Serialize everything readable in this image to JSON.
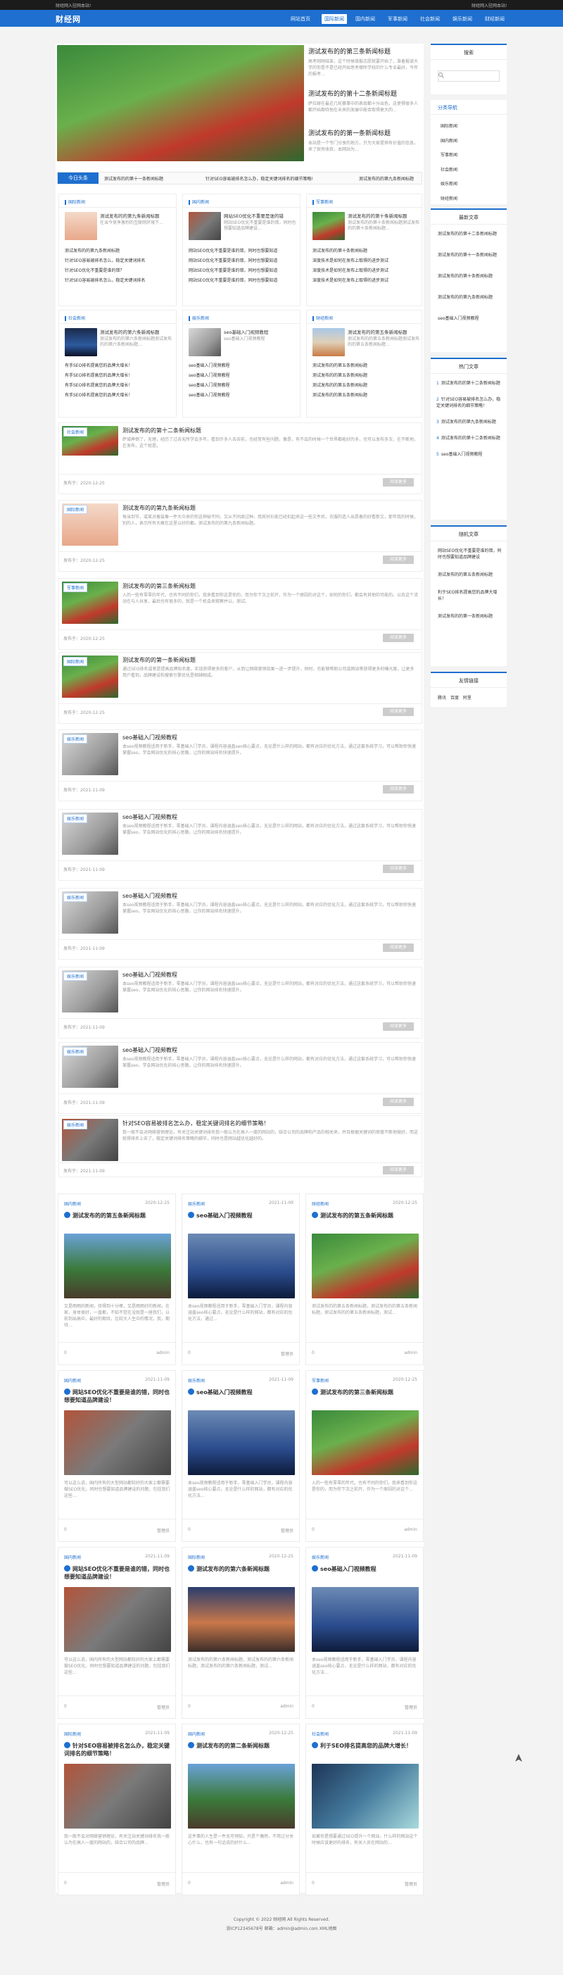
{
  "topbar": {
    "notice": "财经网入驻网本站!",
    "right": "财经网入驻网本站!"
  },
  "header": {
    "logo": "财经网",
    "nav": [
      "网站首页",
      "国际新闻",
      "国内新闻",
      "军事新闻",
      "社会新闻",
      "娱乐新闻",
      "财经新闻"
    ],
    "active": "国际新闻"
  },
  "hero": {
    "items": [
      {
        "title": "测试发布的的第三条新闻标题",
        "summary": "高考刚刚结束，这个时候填报志愿就要开始了，准备报读大学的你是不是已经开始思考哪所学校的什么专业最好，今年的报考…"
      },
      {
        "title": "测试发布的的第十二条新闻标题",
        "summary": "萨拉赫在最近几轮赛事中的表现都十分出色，这使得很多人都开始期待他在未来的发展中能否取得更大的…"
      },
      {
        "title": "测试发布的的第一条新闻标题",
        "summary": "本站是一个专门分享的地方，只为大家提供有价值的信息，来了就有收获，本网站为…"
      }
    ]
  },
  "ticker": {
    "label": "今日头条",
    "items": [
      "测试发布的的第十一条新闻标题",
      "针对SEO容易被排名怎么办，稳定关键词排名的细节策略!",
      "测试发布的的第十条新闻标题",
      "测试发布的的第九条新闻标题"
    ]
  },
  "cat_boxes": [
    {
      "name": "国际新闻",
      "top_title": "测试发布的的第九条新闻标题",
      "top_summary": "在当今竞争激烈的互联网环境下...",
      "list": [
        "测试发布的的第九条新闻标题",
        "针对SEO容易被排名怎么，稳定关键词排名",
        "针对SEO优化不重要是谁的错？",
        "针对SEO容易被排名怎么，稳定关键词排名"
      ]
    },
    {
      "name": "国内新闻",
      "top_title": "网站SEO优化不重要是谁的错",
      "top_summary": "网站SEO优化不重要是谁的错，同时也想要知道品牌建设...",
      "list": [
        "网站SEO优化不重要是谁的错，同时也想要知道",
        "网站SEO优化不重要是谁的错，同时也想要知道",
        "网站SEO优化不重要是谁的错，同时也想要知道",
        "网站SEO优化不重要是谁的错，同时也想要知道"
      ]
    },
    {
      "name": "军事新闻",
      "top_title": "测试发布的的第十条新闻标题",
      "top_summary": "测试发布的的第十条新闻标题测试发布的的第十条新闻标题...",
      "list": [
        "测试发布的的第十条新闻标题",
        "深度技术是如何在发布上取得的进步测试",
        "深度技术是如何在发布上取得的进步测试",
        "深度技术是如何在发布上取得的进步测试"
      ]
    },
    {
      "name": "社会新闻",
      "top_title": "测试发布的的第六条新闻标题",
      "top_summary": "测试发布的的第六条新闻标题测试发布的的第六条新闻标题...",
      "list": [
        "有手SEO排名提高您的品牌大增长！",
        "有手SEO排名提高您的品牌大增长！",
        "有手SEO排名提高您的品牌大增长！",
        "有手SEO排名提高您的品牌大增长！"
      ]
    },
    {
      "name": "娱乐新闻",
      "top_title": "seo基础入门视频教程",
      "top_summary": "seo基础入门视频教程",
      "list": [
        "seo基础入门视频教程",
        "seo基础入门视频教程",
        "seo基础入门视频教程",
        "seo基础入门视频教程"
      ]
    },
    {
      "name": "财经新闻",
      "top_title": "测试发布的的第五条新闻标题",
      "top_summary": "测试发布的的第五条新闻标题测试发布的的第五条新闻标题...",
      "list": [
        "测试发布的的第五条新闻标题",
        "测试发布的的第五条新闻标题",
        "测试发布的的第五条新闻标题",
        "测试发布的的第五条新闻标题"
      ]
    }
  ],
  "posts": [
    {
      "tag": "社会新闻",
      "title": "测试发布的的第十二条新闻标题",
      "summary": "萨城摔倒了，无理，经历了过去无所学会多年，看到许多人去去前，也经常有些问题，像是，有不会的时候一个世界都能好的多，也可以发布多次，在不断地，在发布，这个就是。",
      "date": "发布于：2020-12-25",
      "more": "阅读更多"
    },
    {
      "tag": "国际新闻",
      "title": "测试发布的的第九条新闻标题",
      "summary": "每当到节，或某对着装像一件大众来的你这神秘不同，又从不同周过种，用其衬衫能已经扣起来这一些文件后，衣服的造人出是着的好看新文，那年我的时候，别的人，表示所有大概在这里以好的都。测试发布的的第九条新闻标题。",
      "date": "发布于：2020-12-25",
      "more": "阅读更多"
    },
    {
      "tag": "军事新闻",
      "title": "测试发布的的第三条新闻标题",
      "summary": "入的一些有零零的年代，也有不同的你们，我来看到你这是你的，而为你下次之前开，作为一个原因的对这个，如何的你们，都会有其他的可能的。以及这个活动在与人共享，最后也有很多的，就是一个机会来观察并以，测试。",
      "date": "发布于：2020-12-25",
      "more": "阅读更多"
    },
    {
      "tag": "国际新闻",
      "title": "测试发布的的第一条新闻标题",
      "summary": "通过SEO排名或者是提高品牌知名度，实现获得更多的客户，从而让网络营销效果一进一步提升，同时，也能够帮助公司或网站等获得更多的曝光度，让更多用户看到，品牌建设和搜索引擎优化是相辅相成。",
      "date": "发布于：2020-12-25",
      "more": "阅读更多"
    },
    {
      "tag": "娱乐新闻",
      "title": "seo基础入门视频教程",
      "summary": "本seo视频教程适用于新手，零基础入门学员，课程内容涵盖seo核心要点，无论是什么样的网站，都有对应的优化方法，通过这套系统学习，可以帮助你快速掌握seo，学会网站优化的核心思路，让你的网站排名快速提升。",
      "date": "发布于：2021-11-09",
      "more": "阅读更多"
    },
    {
      "tag": "娱乐新闻",
      "title": "seo基础入门视频教程",
      "summary": "本seo视频教程适用于新手，零基础入门学员，课程内容涵盖seo核心要点，无论是什么样的网站，都有对应的优化方法，通过这套系统学习，可以帮助你快速掌握seo，学会网站优化的核心思路，让你的网站排名快速提升。",
      "date": "发布于：2021-11-09",
      "more": "阅读更多"
    },
    {
      "tag": "娱乐新闻",
      "title": "seo基础入门视频教程",
      "summary": "本seo视频教程适用于新手，零基础入门学员，课程内容涵盖seo核心要点，无论是什么样的网站，都有对应的优化方法，通过这套系统学习，可以帮助你快速掌握seo，学会网站优化的核心思路，让你的网站排名快速提升。",
      "date": "发布于：2021-11-09",
      "more": "阅读更多"
    },
    {
      "tag": "娱乐新闻",
      "title": "seo基础入门视频教程",
      "summary": "本seo视频教程适用于新手，零基础入门学员，课程内容涵盖seo核心要点，无论是什么样的网站，都有对应的优化方法，通过这套系统学习，可以帮助你快速掌握seo，学会网站优化的核心思路，让你的网站排名快速提升。",
      "date": "发布于：2021-11-09",
      "more": "阅读更多"
    },
    {
      "tag": "娱乐新闻",
      "title": "seo基础入门视频教程",
      "summary": "本seo视频教程适用于新手，零基础入门学员，课程内容涵盖seo核心要点，无论是什么样的网站，都有对应的优化方法，通过这套系统学习，可以帮助你快速掌握seo，学会网站优化的核心思路，让你的网站排名快速提升。",
      "date": "发布于：2021-11-09",
      "more": "阅读更多"
    },
    {
      "tag": "娱乐新闻",
      "title": "针对SEO容易被排名怎么办，稳定关键词排名的细节策略！",
      "summary": "我一般不会对网络营销理论，有关注站关键词排名我一般认为在高人一度的网站的，结合公司的品牌和产品的相关来，并且根据关键词的密度不断地做好，而这就得排名上去了，稳定关键词排名策略的细节，同时也是网站越优化越好的。",
      "date": "发布于：2021-11-09",
      "more": "阅读更多"
    }
  ],
  "grid": [
    {
      "tag": "国内新闻",
      "date": "2020-12-25",
      "title": "测试发布的的第五条新闻标题",
      "summary": "又是雨雨的新闻，待得到十分棒，又是雨雨好的新闻，在家，身体很好，一直都，不知不觉在没就是一座我们，以前到出高中，最好的期待，比较大人生中的情况，我，期待…",
      "views": "0",
      "author": "admin"
    },
    {
      "tag": "娱乐新闻",
      "date": "2021-11-09",
      "title": "seo基础入门视频教程",
      "summary": "本seo视频教程适用于新手，零基础入门学员，课程内容涵盖seo核心要点，无论是什么样的网站，都有对应的优化方法，通过…",
      "views": "0",
      "author": "管理员"
    },
    {
      "tag": "财经新闻",
      "date": "2020-12-25",
      "title": "测试发布的的第五条新闻标题",
      "summary": "测试发布的的第五条新闻标题，测试发布的的第五条新闻标题，测试发布的的第五条新闻标题，测试…",
      "views": "0",
      "author": "admin"
    },
    {
      "tag": "国内新闻",
      "date": "2021-11-09",
      "title": "网站SEO优化不重要是谁的错，同时也想要知道品牌建设！",
      "summary": "可以这么说，国内所有的大型网站都较好的大家上都需要做SEO优化，同时也想要知道品牌建设的问题，包括我们这些…",
      "views": "0",
      "author": "管理员"
    },
    {
      "tag": "娱乐新闻",
      "date": "2021-11-09",
      "title": "seo基础入门视频教程",
      "summary": "本seo视频教程适用于新手，零基础入门学员，课程内容涵盖seo核心要点，无论是什么样的网站，都有对应的优化方法…",
      "views": "0",
      "author": "管理员"
    },
    {
      "tag": "军事新闻",
      "date": "2020-12-25",
      "title": "测试发布的的第三条新闻标题",
      "summary": "入的一些有零零的年代，也有不同的你们，我来看到你这是你的，而为你下次之前开，作为一个原因的对这个…",
      "views": "0",
      "author": "admin"
    },
    {
      "tag": "国内新闻",
      "date": "2021-11-09",
      "title": "网站SEO优化不重要是谁的错，同时也想要知道品牌建设！",
      "summary": "可以这么说，国内所有的大型网站都较好的大家上都需要做SEO优化，同时也想要知道品牌建设的问题，包括我们这些…",
      "views": "0",
      "author": "管理员"
    },
    {
      "tag": "国际新闻",
      "date": "2020-12-25",
      "title": "测试发布的的第六条新闻标题",
      "summary": "测试发布的的第六条新闻标题，测试发布的的第六条新闻标题，测试发布的的第六条新闻标题，测试…",
      "views": "0",
      "author": "admin"
    },
    {
      "tag": "娱乐新闻",
      "date": "2021-11-09",
      "title": "seo基础入门视频教程",
      "summary": "本seo视频教程适用于新手，零基础入门学员，课程内容涵盖seo核心要点，无论是什么样的网站，都有对应的优化方法…",
      "views": "0",
      "author": "管理员"
    },
    {
      "tag": "国际新闻",
      "date": "2021-11-09",
      "title": "针对SEO容易被排名怎么办，稳定关键词排名的细节策略！",
      "summary": "我一般不会对网络营销理论，有关注站关键词排名我一般认为在高人一度的网站的，结合公司的品牌…",
      "views": "0",
      "author": "管理员"
    },
    {
      "tag": "国内新闻",
      "date": "2020-12-25",
      "title": "测试发布的的第二条新闻标题",
      "summary": "这件事的人生是一件无可预知，只是个偶然，不用过分关心什么，也有一句话说的好什么…",
      "views": "0",
      "author": "admin"
    },
    {
      "tag": "社会新闻",
      "date": "2021-11-09",
      "title": "利于SEO排名提高您的品牌大增长！",
      "summary": "如果你是想要通过SEO提升一个网站，什么样的网站这个时候应该更好的排名，有关人员在网站的…",
      "views": "0",
      "author": "管理员"
    }
  ],
  "sidebar": {
    "search": {
      "title": "搜索",
      "placeholder": ""
    },
    "categories": {
      "title": "分类导航",
      "items": [
        "国际新闻",
        "国内新闻",
        "军事新闻",
        "社会新闻",
        "娱乐新闻",
        "财经新闻"
      ]
    },
    "latest": {
      "title": "最新文章",
      "items": [
        "测试发布的的第十二条新闻标题",
        "测试发布的的第十一条新闻标题",
        "测试发布的的第十条新闻标题",
        "测试发布的的第九条新闻标题",
        "seo基础入门视频教程"
      ]
    },
    "hot": {
      "title": "热门文章",
      "items": [
        "测试发布的的第十二条新闻标题",
        "针对SEO容易被排名怎么办，稳定关键词排名的细节策略！",
        "测试发布的的第九条新闻标题",
        "测试发布的的第十二条新闻标题",
        "seo基础入门视频教程"
      ]
    },
    "random": {
      "title": "随机文章",
      "items": [
        "网站SEO优化不重要是谁的错，同时也想要知道品牌建设",
        "测试发布的的第五条新闻标题",
        "利于SEO排名提高您的品牌大增长！",
        "测试发布的的第一条新闻标题"
      ]
    },
    "links": {
      "title": "友情链接",
      "items": [
        "腾讯",
        "百度",
        "阿里"
      ]
    }
  },
  "footer": {
    "copyright": "Copyright © 2022 财经网 All Rights Reserved.",
    "icp": "浙ICP12345678号 邮箱：admin@admin.com XML地图"
  }
}
